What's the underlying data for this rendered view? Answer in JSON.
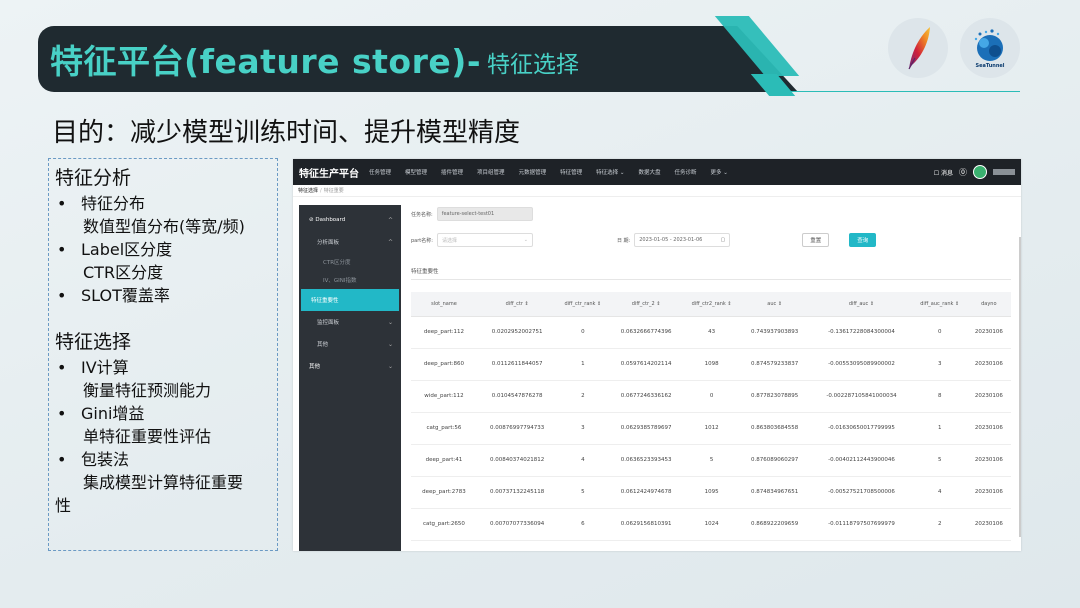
{
  "slide": {
    "title_main": "特征平台(feature store)-",
    "title_sub": "特征选择",
    "purpose": "目的：减少模型训练时间、提升模型精度",
    "logos": [
      "apache-feather-logo",
      "seatunnel-logo"
    ],
    "seatunnel_text": "SeaTunnel",
    "accent_color": "#48d1c6"
  },
  "left": {
    "section1_title": "特征分析",
    "section1_items": [
      {
        "bullet": "•",
        "label": " 特征分布",
        "detail": "数值型值分布(等宽/频)"
      },
      {
        "bullet": "•",
        "label": " Label区分度",
        "detail": "CTR区分度"
      },
      {
        "bullet": "•",
        "label": "SLOT覆盖率",
        "detail": ""
      }
    ],
    "section2_title": "特征选择",
    "section2_items": [
      {
        "bullet": "•",
        "label": "IV计算",
        "detail": "衡量特征预测能力"
      },
      {
        "bullet": "•",
        "label": "Gini增益",
        "detail": "单特征重要性评估"
      },
      {
        "bullet": "•",
        "label": "包装法",
        "detail": "集成模型计算特征重要"
      }
    ],
    "section2_tail": "性"
  },
  "app": {
    "brand": "特征生产平台",
    "nav": [
      "任务管理",
      "模型管理",
      "插件管理",
      "项目组管理",
      "元数据管理",
      "特征管理",
      "特征选择 ⌄",
      "数据大盘",
      "任务诊断",
      "更多 ⌄"
    ],
    "msg": "☐ 消息",
    "help": "⓪",
    "breadcrumb": [
      "特征选择",
      "/",
      "特征重要"
    ],
    "sidebar": [
      {
        "label": "⊘ Dashboard",
        "caret": "^",
        "kind": "top"
      },
      {
        "label": "分析面板",
        "caret": "^",
        "kind": "sub"
      },
      {
        "label": "CTR区分度",
        "caret": "",
        "kind": "subsub"
      },
      {
        "label": "IV、GINI指数",
        "caret": "",
        "kind": "subsub"
      },
      {
        "label": "特征重要性",
        "caret": "",
        "kind": "active"
      },
      {
        "label": "监控面板",
        "caret": "⌄",
        "kind": "sub"
      },
      {
        "label": "其他",
        "caret": "⌄",
        "kind": "sub"
      },
      {
        "label": "其他",
        "caret": "⌄",
        "kind": "top"
      }
    ],
    "form": {
      "task_label": "任务名称:",
      "task_value": "feature-select-test01",
      "part_label": "part名称:",
      "part_placeholder": "请选择",
      "date_label": "日 期:",
      "date_value": "2023-01-05  -  2023-01-06",
      "reset": "重置",
      "query": "查询"
    },
    "section_label": "特征重要性",
    "table": {
      "headers": [
        "slot_name",
        "diff_ctr ⇕",
        "diff_ctr_rank ⇕",
        "diff_ctr_2 ⇕",
        "diff_ctr2_rank ⇕",
        "auc ⇕",
        "diff_auc ⇕",
        "diff_auc_rank ⇕",
        "dayno"
      ],
      "rows": [
        [
          "deep_part:112",
          "0.0202952002751",
          "0",
          "0.0632666774396",
          "43",
          "0.743937903893",
          "-0.13617228084300004",
          "0",
          "20230106"
        ],
        [
          "deep_part:860",
          "0.0112611844057",
          "1",
          "0.0597614202114",
          "1098",
          "0.874579233837",
          "-0.00553095089900002",
          "3",
          "20230106"
        ],
        [
          "wide_part:112",
          "0.0104547876278",
          "2",
          "0.0677246336162",
          "0",
          "0.877823078895",
          "-0.002287105841000034",
          "8",
          "20230106"
        ],
        [
          "catg_part:56",
          "0.00876997794733",
          "3",
          "0.0629385789697",
          "1012",
          "0.863803684558",
          "-0.01630650017799995",
          "1",
          "20230106"
        ],
        [
          "deep_part:41",
          "0.00840374021812",
          "4",
          "0.0636523393453",
          "5",
          "0.876089060297",
          "-0.00402112443900046",
          "5",
          "20230106"
        ],
        [
          "deep_part:2783",
          "0.00737132245118",
          "5",
          "0.0612424974678",
          "1095",
          "0.874834967651",
          "-0.00527521708500006",
          "4",
          "20230106"
        ],
        [
          "catg_part:2650",
          "0.00707077336094",
          "6",
          "0.0629156810391",
          "1024",
          "0.868922209659",
          "-0.01118797507699979",
          "2",
          "20230106"
        ]
      ]
    }
  }
}
